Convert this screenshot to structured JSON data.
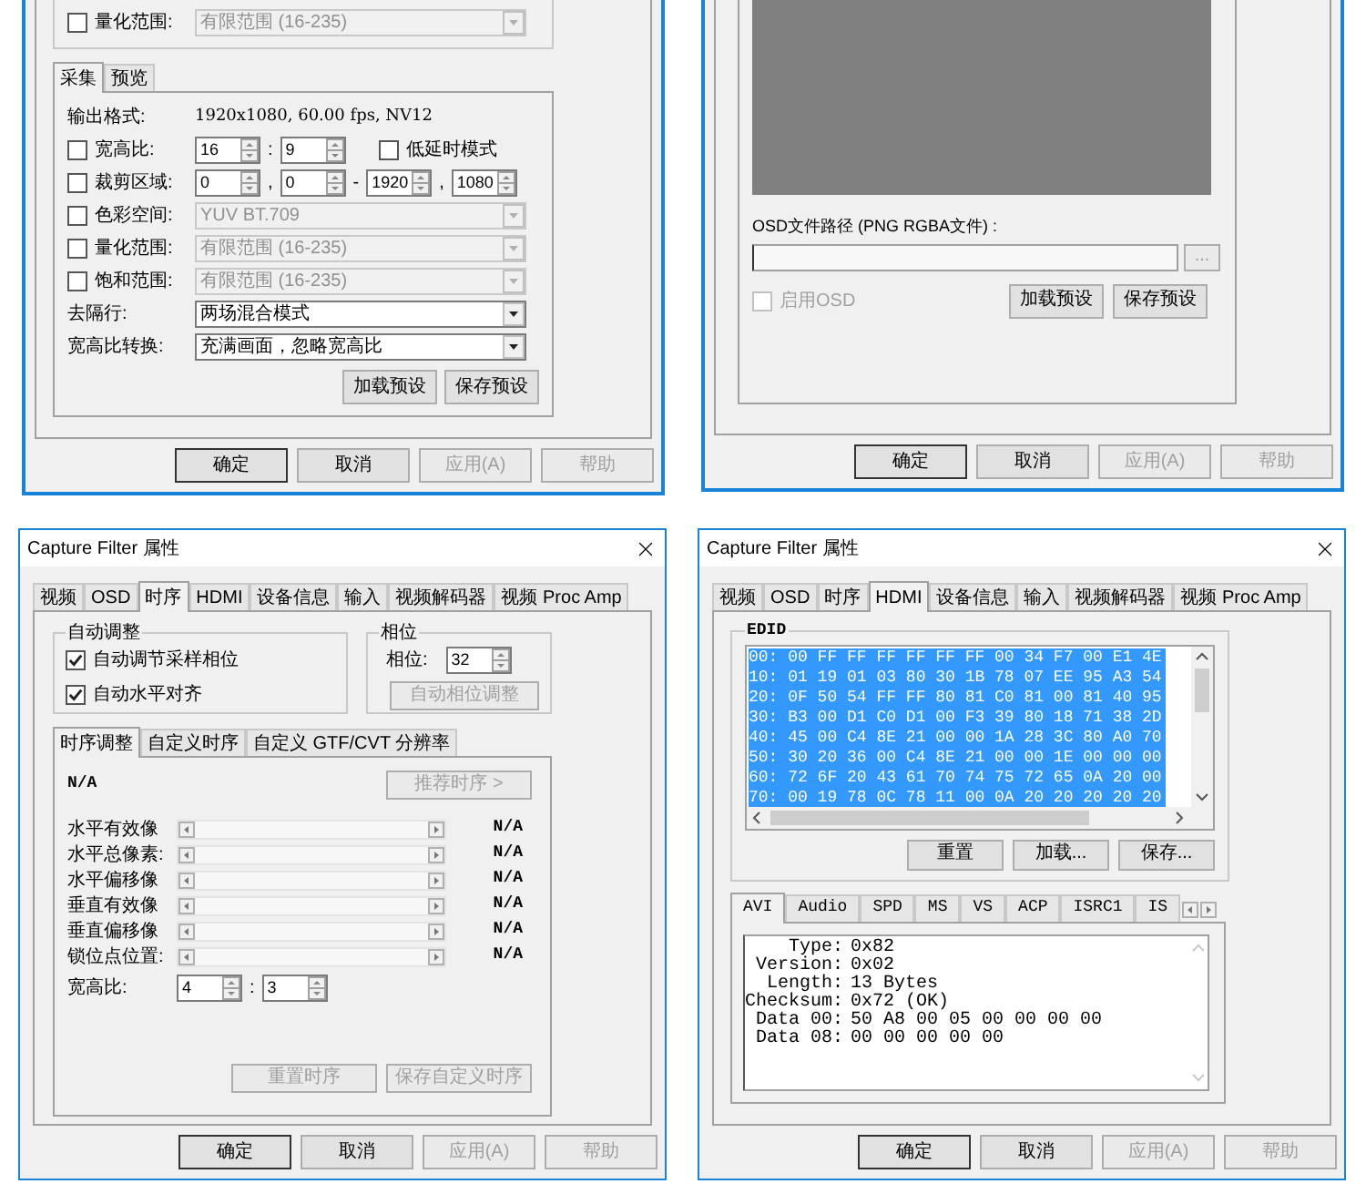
{
  "video_panel": {
    "top_row": {
      "label": "量化范围:",
      "checked": false,
      "value": "有限范围 (16-235)",
      "disabled": true
    },
    "tabs": [
      {
        "label": "采集",
        "selected": true
      },
      {
        "label": "预览",
        "selected": false
      }
    ],
    "rows": [
      {
        "kind": "text",
        "label": "输出格式:",
        "value": "1920x1080, 60.00 fps, NV12"
      },
      {
        "kind": "spins",
        "label": "宽高比:",
        "checked": false,
        "values": [
          "16",
          "9"
        ],
        "separators": [
          ":"
        ],
        "extra": {
          "label": "低延时模式",
          "checked": false
        }
      },
      {
        "kind": "spins",
        "label": "裁剪区域:",
        "checked": false,
        "values": [
          "0",
          "0",
          "1920",
          "1080"
        ],
        "separators": [
          ",",
          "-",
          ","
        ]
      },
      {
        "kind": "select",
        "label": "色彩空间:",
        "checked": false,
        "value": "YUV BT.709",
        "disabled": true
      },
      {
        "kind": "select",
        "label": "量化范围:",
        "checked": false,
        "value": "有限范围 (16-235)",
        "disabled": true
      },
      {
        "kind": "select",
        "label": "饱和范围:",
        "checked": false,
        "value": "有限范围 (16-235)",
        "disabled": true
      },
      {
        "kind": "select",
        "label": "去隔行:",
        "value": "两场混合模式",
        "disabled": false
      },
      {
        "kind": "select",
        "label": "宽高比转换:",
        "value": "充满画面，忽略宽高比",
        "disabled": false
      }
    ],
    "preset_buttons": [
      {
        "label": "加载预设",
        "disabled": false
      },
      {
        "label": "保存预设",
        "disabled": false
      }
    ],
    "footer_buttons": [
      {
        "label": "确定",
        "disabled": false,
        "default": true
      },
      {
        "label": "取消",
        "disabled": false,
        "default": false
      },
      {
        "label": "应用(A)",
        "disabled": true,
        "default": false
      },
      {
        "label": "帮助",
        "disabled": true,
        "default": false
      }
    ]
  },
  "osd_panel": {
    "path_label": "OSD文件路径 (PNG RGBA文件) :",
    "browse_button": {
      "label": "...",
      "disabled": true
    },
    "enable": {
      "label": "启用OSD",
      "checked": false,
      "disabled": true
    },
    "preset_buttons": [
      {
        "label": "加载预设",
        "disabled": false
      },
      {
        "label": "保存预设",
        "disabled": false
      }
    ],
    "footer_buttons": [
      {
        "label": "确定",
        "disabled": false,
        "default": true
      },
      {
        "label": "取消",
        "disabled": false,
        "default": false
      },
      {
        "label": "应用(A)",
        "disabled": true,
        "default": false
      },
      {
        "label": "帮助",
        "disabled": true,
        "default": false
      }
    ]
  },
  "timing_dialog": {
    "title": "Capture Filter 属性",
    "tabs": [
      {
        "label": "视频",
        "selected": false
      },
      {
        "label": "OSD",
        "selected": false
      },
      {
        "label": "时序",
        "selected": true
      },
      {
        "label": "HDMI",
        "selected": false
      },
      {
        "label": "设备信息",
        "selected": false
      },
      {
        "label": "输入",
        "selected": false
      },
      {
        "label": "视频解码器",
        "selected": false
      },
      {
        "label": "视频 Proc Amp",
        "selected": false
      }
    ],
    "auto_group": {
      "title": "自动调整",
      "checks": [
        {
          "label": "自动调节采样相位",
          "checked": true
        },
        {
          "label": "自动水平对齐",
          "checked": true
        }
      ]
    },
    "phase_group": {
      "title": "相位",
      "label": "相位:",
      "value": "32",
      "button": {
        "label": "自动相位调整",
        "disabled": true
      }
    },
    "subtabs": [
      {
        "label": "时序调整",
        "selected": true
      },
      {
        "label": "自定义时序",
        "selected": false
      },
      {
        "label": "自定义 GTF/CVT 分辨率",
        "selected": false
      }
    ],
    "status": "N/A",
    "recommend_button": {
      "label": "推荐时序 >",
      "disabled": true
    },
    "sliders": [
      {
        "label": "水平有效像",
        "reading": "N/A"
      },
      {
        "label": "水平总像素:",
        "reading": "N/A"
      },
      {
        "label": "水平偏移像",
        "reading": "N/A"
      },
      {
        "label": "垂直有效像",
        "reading": "N/A"
      },
      {
        "label": "垂直偏移像",
        "reading": "N/A"
      },
      {
        "label": "锁位点位置:",
        "reading": "N/A"
      }
    ],
    "aspect": {
      "label": "宽高比:",
      "values": [
        "4",
        "3"
      ],
      "separators": [
        ":"
      ]
    },
    "action_buttons": [
      {
        "label": "重置时序",
        "disabled": true
      },
      {
        "label": "保存自定义时序",
        "disabled": true
      }
    ],
    "footer_buttons": [
      {
        "label": "确定",
        "disabled": false,
        "default": true
      },
      {
        "label": "取消",
        "disabled": false,
        "default": false
      },
      {
        "label": "应用(A)",
        "disabled": true,
        "default": false
      },
      {
        "label": "帮助",
        "disabled": true,
        "default": false
      }
    ]
  },
  "hdmi_dialog": {
    "title": "Capture Filter 属性",
    "tabs": [
      {
        "label": "视频",
        "selected": false
      },
      {
        "label": "OSD",
        "selected": false
      },
      {
        "label": "时序",
        "selected": false
      },
      {
        "label": "HDMI",
        "selected": true
      },
      {
        "label": "设备信息",
        "selected": false
      },
      {
        "label": "输入",
        "selected": false
      },
      {
        "label": "视频解码器",
        "selected": false
      },
      {
        "label": "视频 Proc Amp",
        "selected": false
      }
    ],
    "edid": {
      "title": "EDID",
      "lines": [
        {
          "text": "00: 00 FF FF FF FF FF FF 00 34 F7 00 E1 4E",
          "selected": true
        },
        {
          "text": "10: 01 19 01 03 80 30 1B 78 07 EE 95 A3 54",
          "selected": true
        },
        {
          "text": "20: 0F 50 54 FF FF 80 81 C0 81 00 81 40 95",
          "selected": true
        },
        {
          "text": "30: B3 00 D1 C0 D1 00 F3 39 80 18 71 38 2D",
          "selected": true
        },
        {
          "text": "40: 45 00 C4 8E 21 00 00 1A 28 3C 80 A0 70",
          "selected": true
        },
        {
          "text": "50: 30 20 36 00 C4 8E 21 00 00 1E 00 00 00",
          "selected": true
        },
        {
          "text": "60: 72 6F 20 43 61 70 74 75 72 65 0A 20 00",
          "selected": true
        },
        {
          "text": "70: 00 19 78 0C 78 11 00 0A 20 20 20 20 20",
          "selected": true
        }
      ],
      "buttons": [
        {
          "label": "重置",
          "disabled": false
        },
        {
          "label": "加载...",
          "disabled": false
        },
        {
          "label": "保存...",
          "disabled": false
        }
      ]
    },
    "subtabs": [
      {
        "label": "AVI",
        "selected": true
      },
      {
        "label": "Audio",
        "selected": false
      },
      {
        "label": "SPD",
        "selected": false
      },
      {
        "label": "MS",
        "selected": false
      },
      {
        "label": "VS",
        "selected": false
      },
      {
        "label": "ACP",
        "selected": false
      },
      {
        "label": "ISRC1",
        "selected": false
      },
      {
        "label": "IS",
        "selected": false
      }
    ],
    "infoframe": [
      {
        "label": "Type:",
        "value": "0x82"
      },
      {
        "label": "Version:",
        "value": "0x02"
      },
      {
        "label": "Length:",
        "value": "13 Bytes"
      },
      {
        "label": "Checksum:",
        "value": "0x72 (OK)"
      },
      {
        "label": "Data 00:",
        "value": "50 A8 00 05 00 00 00 00"
      },
      {
        "label": "Data 08:",
        "value": "00 00 00 00 00"
      }
    ],
    "footer_buttons": [
      {
        "label": "确定",
        "disabled": false,
        "default": true
      },
      {
        "label": "取消",
        "disabled": false,
        "default": false
      },
      {
        "label": "应用(A)",
        "disabled": true,
        "default": false
      },
      {
        "label": "帮助",
        "disabled": true,
        "default": false
      }
    ]
  }
}
